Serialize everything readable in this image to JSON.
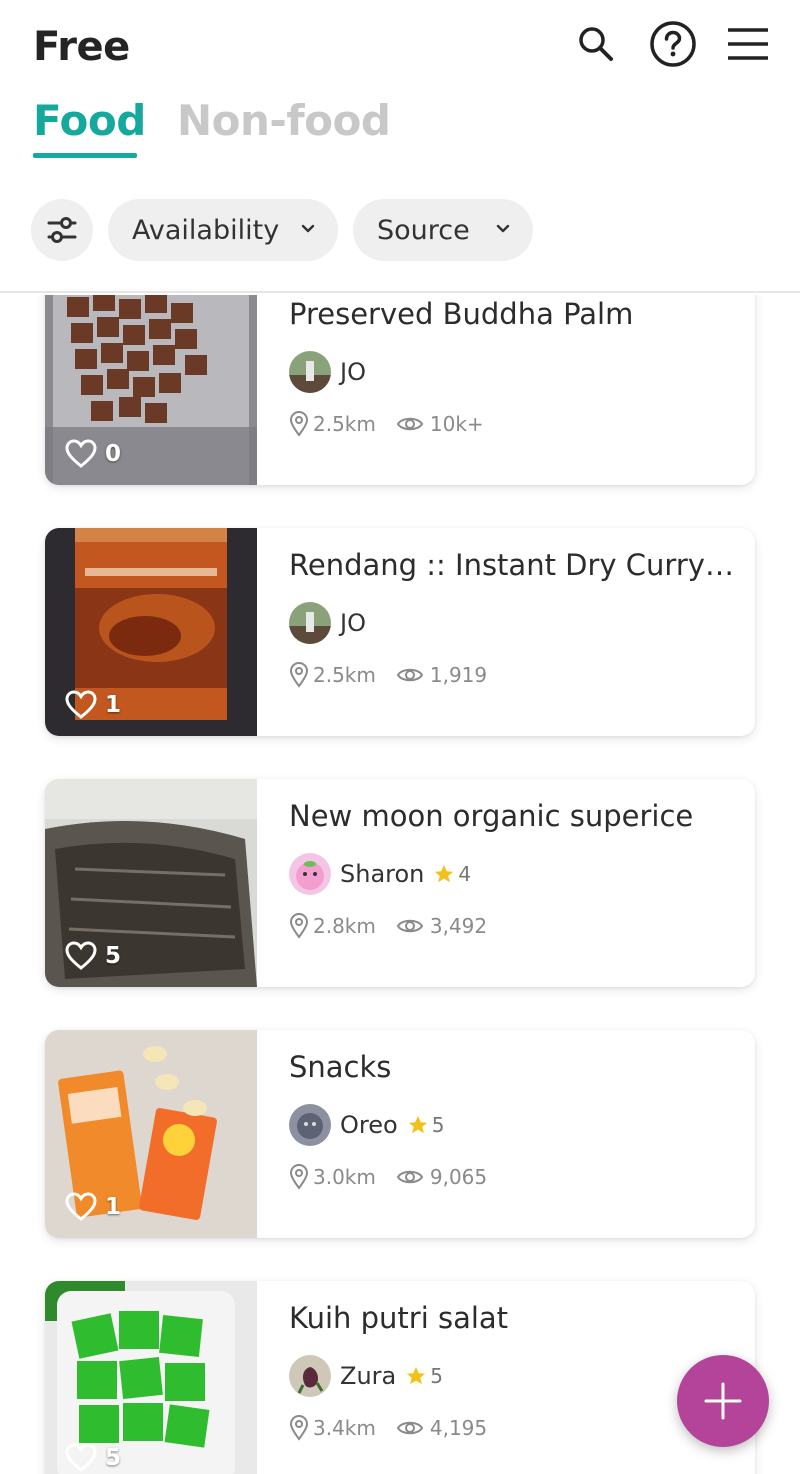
{
  "app": {
    "title": "Free"
  },
  "header_icons": [
    "search-icon",
    "help-icon",
    "menu-icon"
  ],
  "tabs": [
    {
      "label": "Food",
      "active": true
    },
    {
      "label": "Non-food",
      "active": false
    }
  ],
  "filters": {
    "icon": "sliders-icon",
    "chips": [
      {
        "label": "Availability"
      },
      {
        "label": "Source"
      }
    ]
  },
  "listings": [
    {
      "title": "Preserved Buddha Palm",
      "user": "JO",
      "rating": "",
      "distance": "2.5km",
      "views": "10k+",
      "likes": "0"
    },
    {
      "title": "Rendang :: Instant Dry Curry Paste",
      "user": "JO",
      "rating": "",
      "distance": "2.5km",
      "views": "1,919",
      "likes": "1"
    },
    {
      "title": "New moon organic superice",
      "user": "Sharon",
      "rating": "4",
      "distance": "2.8km",
      "views": "3,492",
      "likes": "5"
    },
    {
      "title": "Snacks",
      "user": "Oreo",
      "rating": "5",
      "distance": "3.0km",
      "views": "9,065",
      "likes": "1"
    },
    {
      "title": "Kuih putri salat",
      "user": "Zura",
      "rating": "5",
      "distance": "3.4km",
      "views": "4,195",
      "likes": "5"
    }
  ],
  "colors": {
    "accent": "#15a89c",
    "fab": "#b4449a",
    "star": "#f2c21b"
  },
  "fab": {
    "icon": "plus-icon"
  }
}
